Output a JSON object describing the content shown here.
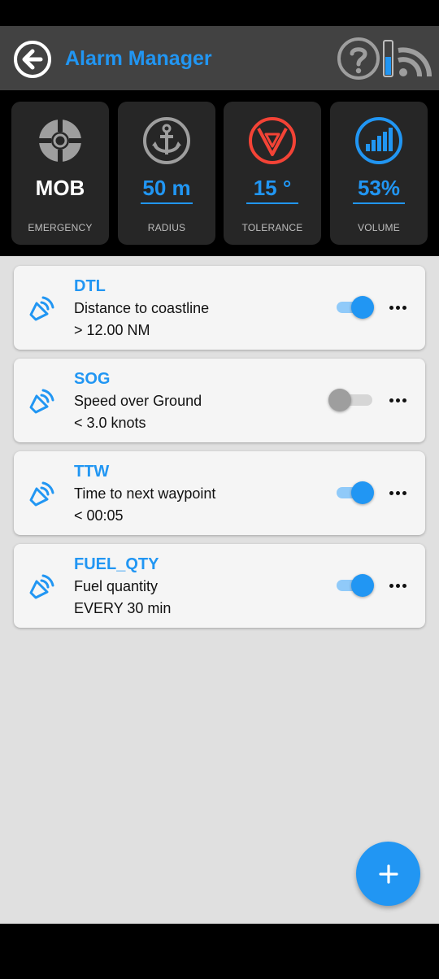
{
  "app": {
    "title": "Alarm Manager"
  },
  "header": {
    "back_icon": "arrow-left-circle-icon",
    "help_icon": "question-circle-icon",
    "signal_icon": "wifi-signal-icon"
  },
  "tiles": [
    {
      "value": "MOB",
      "label": "EMERGENCY",
      "icon": "lifebuoy-icon",
      "value_color": "#ffffff"
    },
    {
      "value": "50 m",
      "label": "RADIUS",
      "icon": "anchor-icon",
      "value_color": "#2196f3"
    },
    {
      "value": "15 °",
      "label": "TOLERANCE",
      "icon": "heading-tolerance-icon",
      "value_color": "#2196f3"
    },
    {
      "value": "53%",
      "label": "VOLUME",
      "icon": "volume-bars-icon",
      "value_color": "#2196f3"
    }
  ],
  "alarms": [
    {
      "code": "DTL",
      "name": "Distance to coastline",
      "condition": "> 12.00 NM",
      "enabled": true
    },
    {
      "code": "SOG",
      "name": "Speed over Ground",
      "condition": "< 3.0 knots",
      "enabled": false
    },
    {
      "code": "TTW",
      "name": "Time to next waypoint",
      "condition": "< 00:05",
      "enabled": true
    },
    {
      "code": "FUEL_QTY",
      "name": "Fuel quantity",
      "condition": "EVERY 30 min",
      "enabled": true
    }
  ],
  "fab": {
    "icon": "plus-icon"
  },
  "colors": {
    "accent": "#2196f3",
    "app_bar": "#424242",
    "tile_bg": "#262626",
    "content_bg": "#e0e0e0",
    "card_bg": "#f5f5f5",
    "alert_red": "#f44336"
  }
}
